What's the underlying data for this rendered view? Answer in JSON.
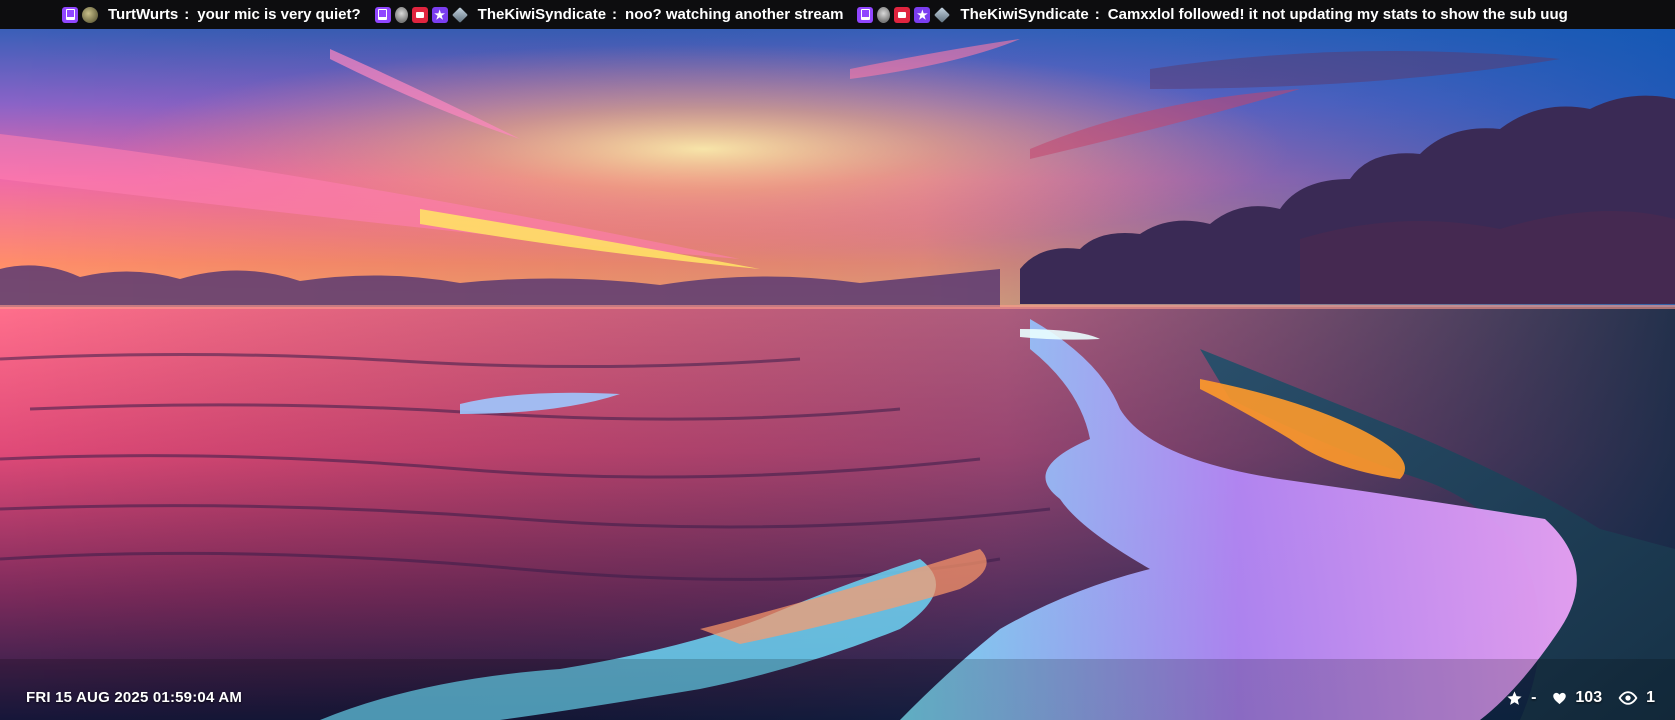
{
  "ticker": {
    "messages": [
      {
        "user": "TurtWurts",
        "separator": ":",
        "text": "your mic is very quiet?",
        "badges": [
          "twitch-badge",
          "moss-badge"
        ]
      },
      {
        "user": "TheKiwiSyndicate",
        "separator": ":",
        "text": "noo?  watching another stream",
        "badges": [
          "twitch-badge",
          "mouse-badge",
          "camera-badge",
          "star-badge",
          "gem-badge"
        ]
      },
      {
        "user": "TheKiwiSyndicate",
        "separator": ":",
        "text": "Camxxlol followed!  it not updating my stats to show the sub uug",
        "badges": [
          "twitch-badge",
          "mouse-badge",
          "camera-badge",
          "star-badge",
          "gem-badge"
        ]
      }
    ]
  },
  "overlay": {
    "datetime": "FRI 15 AUG 2025 01:59:04 AM",
    "stats": {
      "followers_icon": "star-icon",
      "followers_value": "-",
      "likes_icon": "heart-icon",
      "likes_value": "103",
      "viewers_icon": "eye-icon",
      "viewers_value": "1"
    }
  },
  "colors": {
    "ticker_bg": "#0d0d0f",
    "twitch_purple": "#9146ff",
    "overlay_text": "#ffffff"
  }
}
